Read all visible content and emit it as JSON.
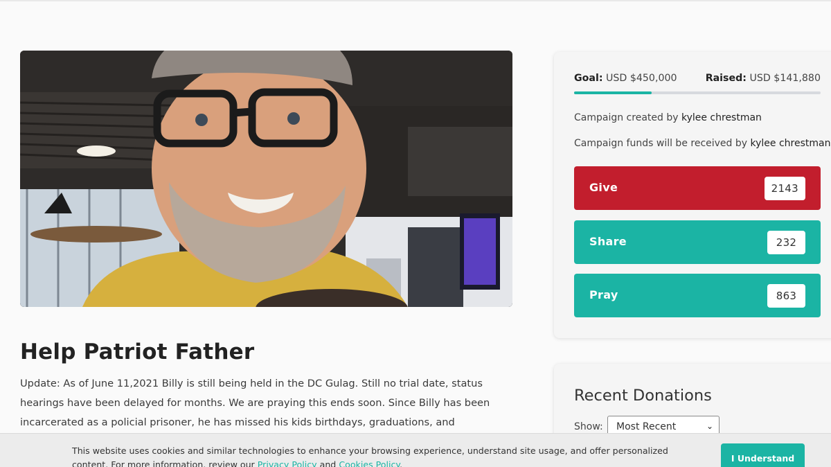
{
  "campaign": {
    "title": "Help Patriot Father",
    "description": "Update: As of June 11,2021 Billy is still being held in the DC Gulag. Still no trial date, status hearings have been delayed for months. We are praying this ends soon. Since Billy has been incarcerated as a policial prisoner, he has missed his kids birthdays, graduations, and"
  },
  "funding": {
    "goal_label": "Goal:",
    "goal_value": "USD $450,000",
    "raised_label": "Raised:",
    "raised_value": "USD $141,880",
    "progress_fraction": 0.315
  },
  "meta": {
    "created_prefix": "Campaign created by",
    "created_by": "kylee chrestman",
    "received_prefix": "Campaign funds will be received by",
    "received_by": "kylee chrestman"
  },
  "actions": {
    "give_label": "Give",
    "give_count": "2143",
    "share_label": "Share",
    "share_count": "232",
    "pray_label": "Pray",
    "pray_count": "863"
  },
  "donations": {
    "title": "Recent Donations",
    "show_label": "Show:",
    "sort_selected": "Most Recent"
  },
  "cookie": {
    "text_part1": "This website uses cookies and similar technologies to enhance your browsing experience, understand site usage, and offer personalized content. For more information, review our",
    "privacy_link": "Privacy Policy",
    "and_text": "and",
    "cookies_link": "Cookies Policy",
    "end_text": ".",
    "button_label": "I Understand"
  },
  "colors": {
    "give": "#c21e2d",
    "teal": "#1bb4a4",
    "progress_track": "#d7d9de"
  }
}
